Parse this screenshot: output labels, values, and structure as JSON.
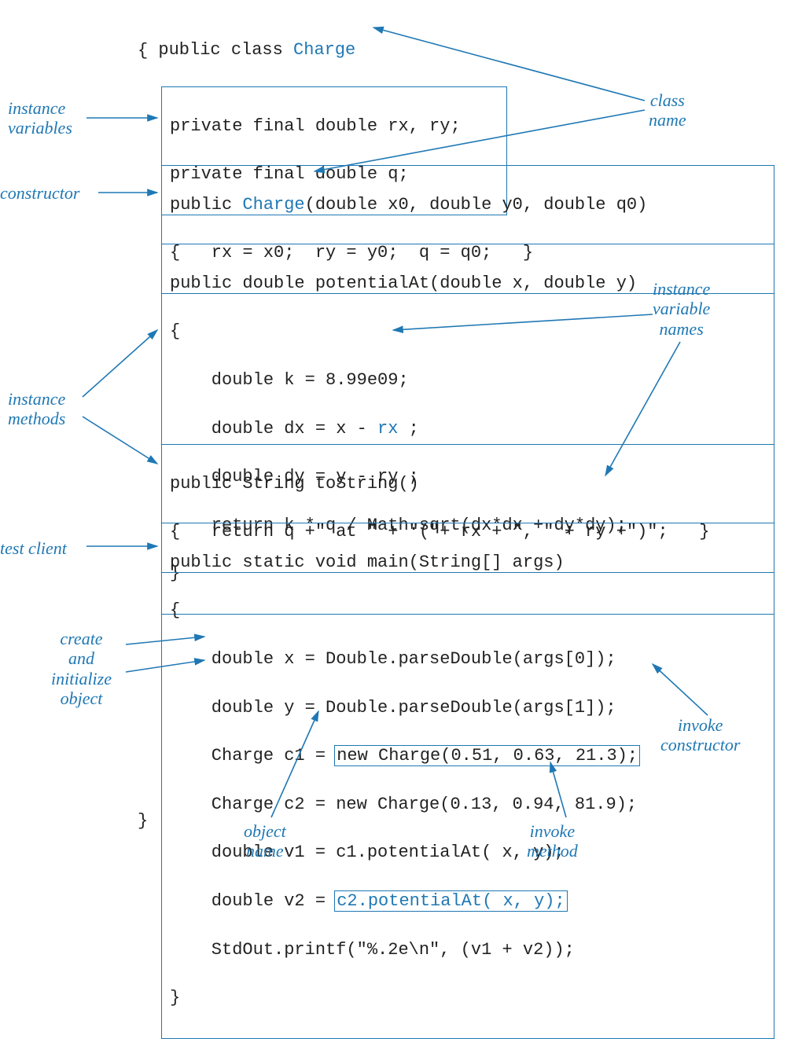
{
  "labels": {
    "instance_variables": "instance\nvariables",
    "constructor": "constructor",
    "instance_methods": "instance\nmethods",
    "test_client": "test client",
    "create_initialize": "create\nand\ninitialize\nobject",
    "class_name": "class\nname",
    "instance_variable_names": "instance\nvariable\nnames",
    "invoke_constructor": "invoke\nconstructor",
    "invoke_method": "invoke\nmethod",
    "object_name": "object\nname"
  },
  "code": {
    "header_pre": "public class ",
    "header_class": "Charge",
    "open_brace": "{",
    "ivars_l1": "private final double rx, ry;",
    "ivars_l2": "private final double q;",
    "ctor_l1a": "public ",
    "ctor_l1b": "Charge",
    "ctor_l1c": "(double x0, double y0, double q0)",
    "ctor_l2": "{   rx = x0;  ry = y0;  q = q0;   }",
    "pa_l1": "public double potentialAt(double x, double y)",
    "pa_l2": "{",
    "pa_l3": "    double k = 8.99e09;",
    "pa_l4a": "    double dx = x - ",
    "pa_l4b": "rx",
    "pa_l4c": " ;",
    "pa_l5": "    double dy = y - ry ;",
    "pa_l6": "    return k * q / Math.sqrt(dx*dx + dy*dy);",
    "pa_l7": "}",
    "ts_l1": "public String toString()",
    "ts_l2": "{   return q +\" at \" + \"(\"+ rx + \", \" + ry +\")\";   }",
    "main_l1": "public static void main(String[] args)",
    "main_l2": "{",
    "main_l3": "    double x = Double.parseDouble(args[0]);",
    "main_l4": "    double y = Double.parseDouble(args[1]);",
    "main_l5a": "    Charge c1 = ",
    "main_new1": "new Charge(0.51, 0.63, 21.3);",
    "main_l6": "    Charge c2 = new Charge(0.13, 0.94, 81.9);",
    "main_l7": "    double v1 = c1.potentialAt( x, y);",
    "main_l8a": "    double v2 = ",
    "main_call2": "c2.potentialAt( x, y);",
    "main_l9": "    StdOut.printf(\"%.2e\\n\", (v1 + v2));",
    "main_l10": "}",
    "close_brace": "}"
  },
  "colors": {
    "accent": "#1f78b4"
  }
}
